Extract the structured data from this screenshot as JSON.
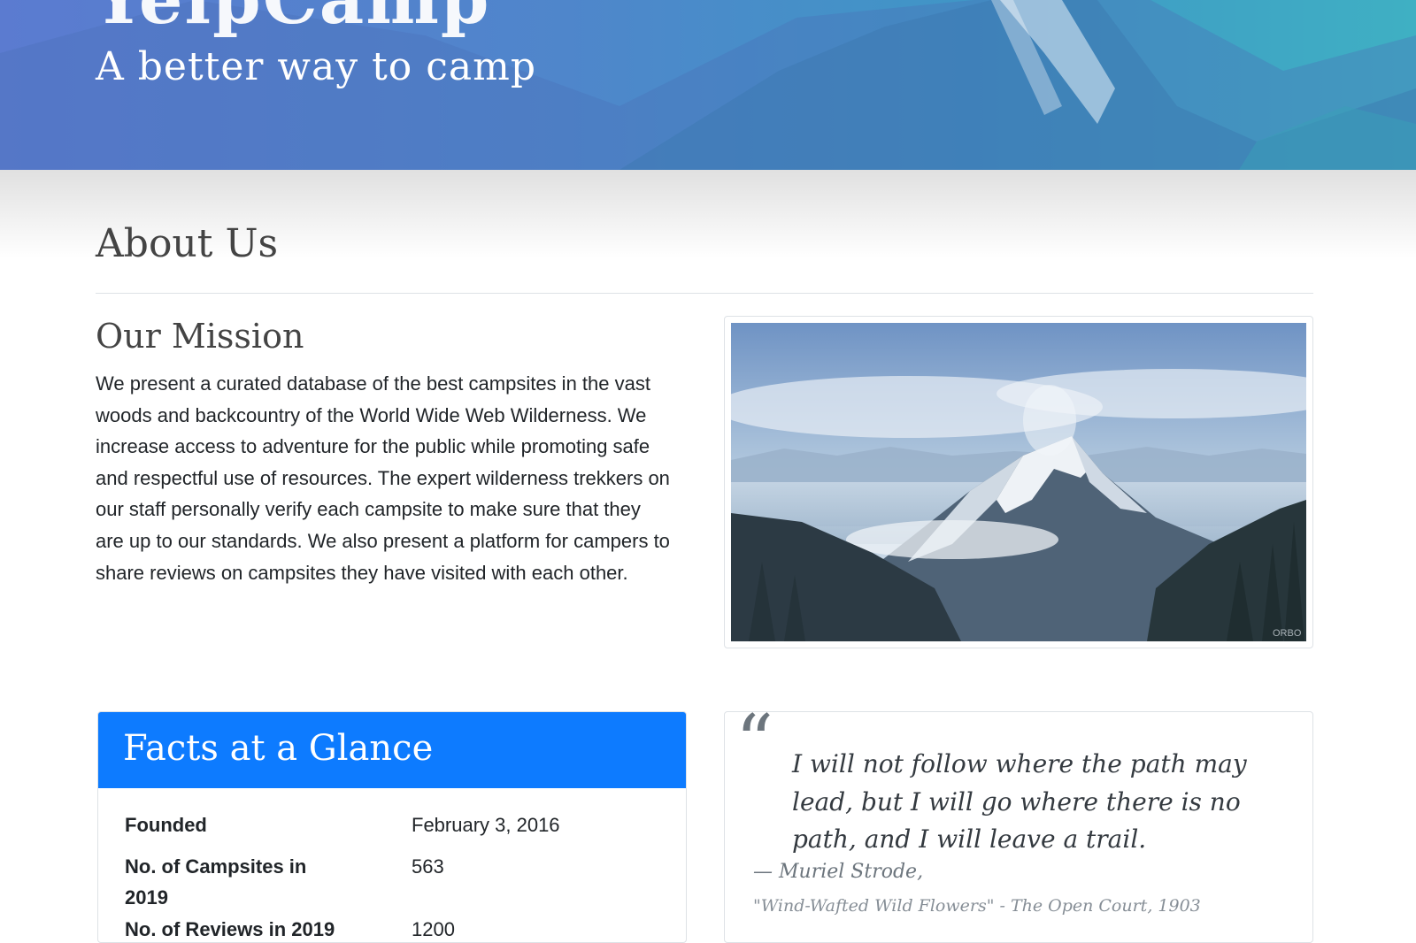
{
  "hero": {
    "title_fragment": "YelpCamp",
    "tagline": "A better way to camp"
  },
  "about": {
    "title": "About Us",
    "mission_heading": "Our Mission",
    "mission_text": "We present a curated database of the best campsites in the vast woods and backcountry of the World Wide Web Wilderness. We increase access to adventure for the public while promoting safe and respectful use of resources. The expert wilderness trekkers on our staff personally verify each campsite to make sure that they are up to our standards. We also present a platform for campers to share reviews on campsites they have visited with each other."
  },
  "image": {
    "subject": "snowy mountain peak above clouds",
    "watermark": "ORBO"
  },
  "facts": {
    "title": "Facts at a Glance",
    "rows": [
      {
        "label": "Founded",
        "value": "February 3, 2016"
      },
      {
        "label": "No. of Campsites in 2019",
        "value": "563"
      },
      {
        "label": "No. of Reviews in 2019",
        "value": "1200"
      }
    ]
  },
  "quote": {
    "mark": "“",
    "text": "I will not follow where the path may lead, but I will go where there is no path, and I will leave a trail.",
    "author": "— Muriel Strode,",
    "source": "\"Wind-Wafted Wild Flowers\" - The Open Court, 1903"
  },
  "colors": {
    "facts_header": "#0d7bff",
    "hero_gradient_start": "#5b7bd0",
    "hero_gradient_end": "#3fb0c3"
  }
}
